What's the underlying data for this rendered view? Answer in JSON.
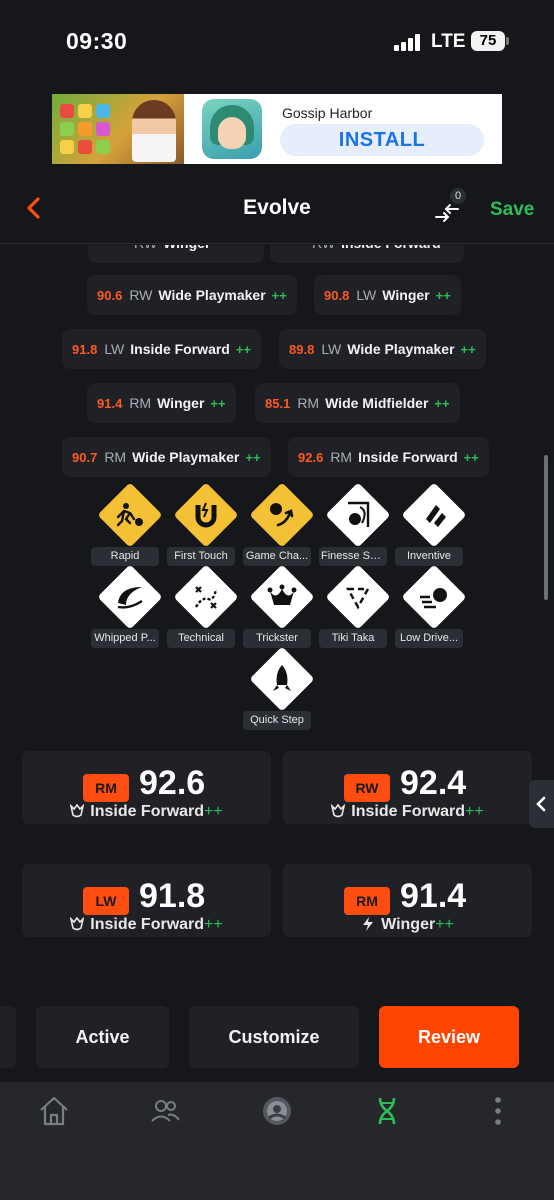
{
  "status": {
    "time": "09:30",
    "network": "LTE",
    "battery": "75"
  },
  "ad": {
    "title": "Gossip Harbor",
    "cta": "INSTALL"
  },
  "header": {
    "title": "Evolve",
    "compare_count": "0",
    "save_label": "Save"
  },
  "chips": [
    {
      "rating": "90.6",
      "pos": "RW",
      "role": "Wide Playmaker",
      "plus": "++"
    },
    {
      "rating": "90.8",
      "pos": "LW",
      "role": "Winger",
      "plus": "++"
    },
    {
      "rating": "91.8",
      "pos": "LW",
      "role": "Inside Forward",
      "plus": "++"
    },
    {
      "rating": "89.8",
      "pos": "LW",
      "role": "Wide Playmaker",
      "plus": "++"
    },
    {
      "rating": "91.4",
      "pos": "RM",
      "role": "Winger",
      "plus": "++"
    },
    {
      "rating": "85.1",
      "pos": "RM",
      "role": "Wide Midfielder",
      "plus": "++"
    },
    {
      "rating": "90.7",
      "pos": "RM",
      "role": "Wide Playmaker",
      "plus": "++"
    },
    {
      "rating": "92.6",
      "pos": "RM",
      "role": "Inside Forward",
      "plus": "++"
    }
  ],
  "chips_partial": [
    {
      "pos": "RW",
      "role": "Winger"
    },
    {
      "pos": "RW",
      "role": "Inside Forward"
    }
  ],
  "playstyles": [
    {
      "label": "Rapid",
      "tier": "gold",
      "icon": "rapid-icon"
    },
    {
      "label": "First Touch",
      "tier": "gold",
      "icon": "magnet-icon"
    },
    {
      "label": "Game Cha...",
      "tier": "gold",
      "icon": "game-changer-icon"
    },
    {
      "label": "Finesse Sh...",
      "tier": "white",
      "icon": "finesse-shot-icon"
    },
    {
      "label": "Inventive",
      "tier": "white",
      "icon": "inventive-icon"
    },
    {
      "label": "Whipped P...",
      "tier": "white",
      "icon": "whipped-pass-icon"
    },
    {
      "label": "Technical",
      "tier": "white",
      "icon": "technical-icon"
    },
    {
      "label": "Trickster",
      "tier": "white",
      "icon": "trickster-icon"
    },
    {
      "label": "Tiki Taka",
      "tier": "white",
      "icon": "tiki-taka-icon"
    },
    {
      "label": "Low Drive...",
      "tier": "white",
      "icon": "low-driven-shot-icon"
    },
    {
      "label": "Quick Step",
      "tier": "white",
      "icon": "quick-step-icon"
    }
  ],
  "cards": [
    {
      "pos": "RM",
      "ovr": "92.6",
      "role": "Inside Forward",
      "plus": "++",
      "icon": "inside-forward-icon"
    },
    {
      "pos": "RW",
      "ovr": "92.4",
      "role": "Inside Forward",
      "plus": "++",
      "icon": "inside-forward-icon"
    },
    {
      "pos": "LW",
      "ovr": "91.8",
      "role": "Inside Forward",
      "plus": "++",
      "icon": "inside-forward-icon"
    },
    {
      "pos": "RM",
      "ovr": "91.4",
      "role": "Winger",
      "plus": "++",
      "icon": "winger-bolt-icon"
    }
  ],
  "tabs": {
    "active": "Active",
    "customize": "Customize",
    "review": "Review"
  },
  "nav": [
    "home-icon",
    "squad-icon",
    "club-icon",
    "evolutions-icon",
    "more-icon"
  ],
  "colors": {
    "accent": "#ff4500",
    "save_green": "#2ebd59",
    "gold": "#f4c035"
  }
}
